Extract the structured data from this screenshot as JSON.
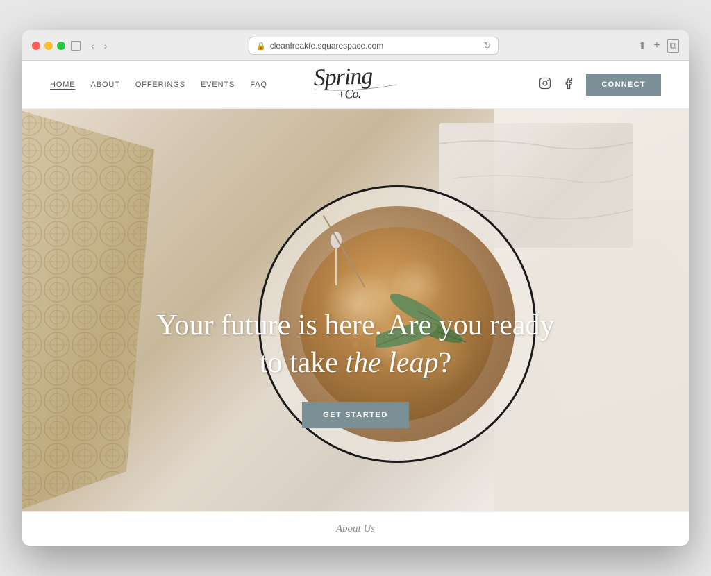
{
  "browser": {
    "url": "cleanfreakfe.squarespace.com",
    "reload_title": "Reload page"
  },
  "nav": {
    "items": [
      {
        "label": "HOME",
        "active": true
      },
      {
        "label": "ABOUT",
        "active": false
      },
      {
        "label": "OFFERINGS",
        "active": false
      },
      {
        "label": "EVENTS",
        "active": false
      },
      {
        "label": "FAQ",
        "active": false
      }
    ],
    "connect_label": "CONNeCT",
    "logo_line1": "Spring",
    "logo_plus": "+",
    "logo_line2": "Co."
  },
  "hero": {
    "headline_line1": "Your future is here. Are you ready",
    "headline_line2_plain": "to take ",
    "headline_line2_italic": "the leap",
    "headline_line2_end": "?",
    "cta_label": "GET STARTED"
  },
  "footer_teaser": {
    "label": "About Us"
  },
  "colors": {
    "connect_bg": "#7a8f96",
    "cta_bg": "#7a8f96",
    "nav_text": "#555555",
    "hero_text": "#ffffff"
  }
}
